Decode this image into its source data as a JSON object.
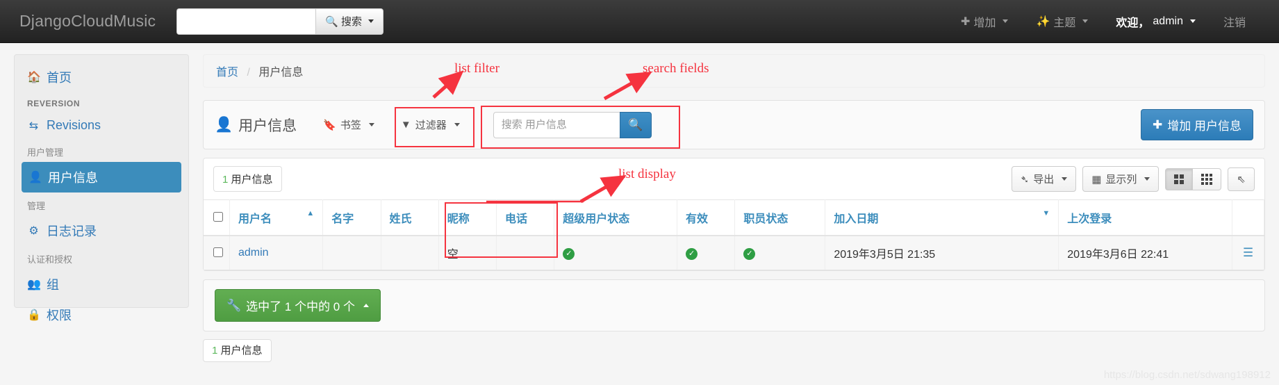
{
  "navbar": {
    "brand": "DjangoCloudMusic",
    "search_value": "",
    "search_placeholder": "",
    "search_button": "搜索",
    "search_icon": "search-icon",
    "links": [
      {
        "label": "增加",
        "icon": "plus-icon",
        "caret": true
      },
      {
        "label": "主题",
        "icon": "magic-wand-icon",
        "caret": true
      },
      {
        "label": "欢迎，",
        "user": "admin",
        "icon": "",
        "caret": true
      },
      {
        "label": "注销",
        "icon": "",
        "caret": false
      }
    ]
  },
  "sidebar": {
    "home": {
      "label": "首页",
      "icon": "home-icon"
    },
    "groups": [
      {
        "title": "REVERSION",
        "caps": true,
        "items": [
          {
            "label": "Revisions",
            "icon": "exchange-icon",
            "active": false
          }
        ]
      },
      {
        "title": "用户管理",
        "caps": false,
        "items": [
          {
            "label": "用户信息",
            "icon": "user-icon",
            "active": true
          }
        ]
      },
      {
        "title": "管理",
        "caps": false,
        "items": [
          {
            "label": "日志记录",
            "icon": "gear-icon",
            "active": false
          }
        ]
      },
      {
        "title": "认证和授权",
        "caps": false,
        "items": [
          {
            "label": "组",
            "icon": "users-icon",
            "active": false
          },
          {
            "label": "权限",
            "icon": "lock-icon",
            "active": false
          }
        ]
      }
    ]
  },
  "breadcrumb": {
    "home": "首页",
    "separator": "/",
    "current": "用户信息"
  },
  "toolbar": {
    "title": "用户信息",
    "title_icon": "user-icon",
    "bookmark_label": "书签",
    "bookmark_icon": "bookmark-icon",
    "filter_label": "过滤器",
    "filter_icon": "funnel-icon",
    "search_placeholder": "搜索 用户信息",
    "search_value": "",
    "search_icon": "search-icon",
    "add_label": "增加 用户信息",
    "add_icon": "plus-icon"
  },
  "results": {
    "count_number": "1",
    "count_label": "用户信息",
    "export_label": "导出",
    "export_icon": "share-icon",
    "columns_label": "显示列",
    "columns_icon": "table-icon",
    "grid_view_icon": "grid-large-icon",
    "list_view_icon": "grid-small-icon",
    "expand_icon": "expand-icon"
  },
  "table": {
    "headers": [
      {
        "label": "用户名",
        "sort": "asc"
      },
      {
        "label": "名字",
        "sort": ""
      },
      {
        "label": "姓氏",
        "sort": ""
      },
      {
        "label": "昵称",
        "sort": ""
      },
      {
        "label": "电话",
        "sort": ""
      },
      {
        "label": "超级用户状态",
        "sort": ""
      },
      {
        "label": "有效",
        "sort": ""
      },
      {
        "label": "职员状态",
        "sort": ""
      },
      {
        "label": "加入日期",
        "sort": "desc"
      },
      {
        "label": "上次登录",
        "sort": ""
      }
    ],
    "rows": [
      {
        "username": "admin",
        "first_name": "",
        "last_name": "",
        "nickname": "空",
        "phone": "",
        "superuser": true,
        "active": true,
        "staff": true,
        "date_joined": "2019年3月5日 21:35",
        "last_login": "2019年3月6日 22:41"
      }
    ]
  },
  "actionbar": {
    "label": "选中了 1 个中的 0 个",
    "icon": "wrench-icon"
  },
  "pager": {
    "count_number": "1",
    "count_label": "用户信息"
  },
  "annotations": [
    {
      "name": "list-filter",
      "text": "list filter"
    },
    {
      "name": "search-fields",
      "text": "search fields"
    },
    {
      "name": "list-display",
      "text": "list display"
    }
  ],
  "watermark": "https://blog.csdn.net/sdwang198912",
  "colors": {
    "navbar": "#2b2b2b",
    "accent": "#3c8dbc",
    "link": "#337ab7",
    "success": "#5cb85c",
    "annotation": "#f5333f"
  }
}
